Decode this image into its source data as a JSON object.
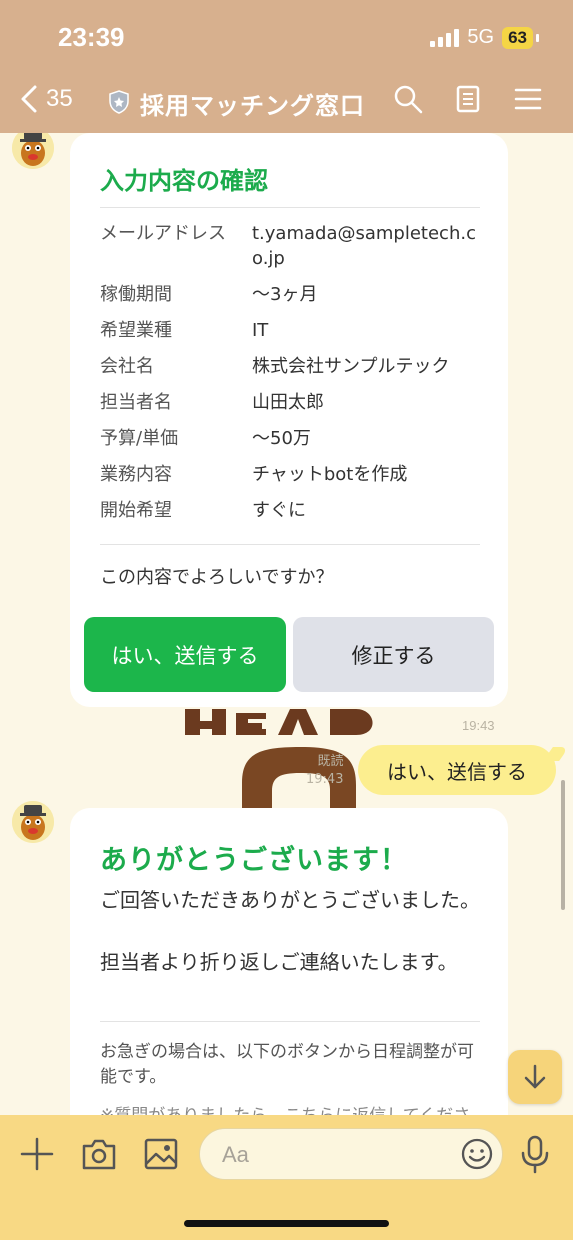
{
  "status": {
    "time": "23:39",
    "network": "5G",
    "battery": "63"
  },
  "header": {
    "back_count": "35",
    "title": "採用マッチング窓口"
  },
  "confirm_card": {
    "title": "入力内容の確認",
    "rows": [
      {
        "label": "メールアドレス",
        "value": "t.yamada@sampletech.co.jp"
      },
      {
        "label": "稼働期間",
        "value": "〜3ヶ月"
      },
      {
        "label": "希望業種",
        "value": "IT"
      },
      {
        "label": "会社名",
        "value": "株式会社サンプルテック"
      },
      {
        "label": "担当者名",
        "value": "山田太郎"
      },
      {
        "label": "予算/単価",
        "value": "〜50万"
      },
      {
        "label": "業務内容",
        "value": "チャットbotを作成"
      },
      {
        "label": "開始希望",
        "value": "すぐに"
      }
    ],
    "question": "この内容でよろしいですか？",
    "yes_label": "はい、送信する",
    "fix_label": "修正する"
  },
  "sticker_time": "19:43",
  "my_message": {
    "text": "はい、送信する",
    "read": "既読",
    "time": "19:43"
  },
  "thanks_card": {
    "title": "ありがとうございます！",
    "line1": "ご回答いただきありがとうございました。",
    "line2": "担当者より折り返しご連絡いたします。",
    "note": "お急ぎの場合は、以下のボタンから日程調整が可能です。",
    "note2": "※質問がありましたら、こちらに返信してください"
  },
  "input": {
    "placeholder": "Aa"
  },
  "colors": {
    "header": "#d7b08e",
    "accent_green": "#1cb64b",
    "bubble_yellow": "#fcee8f",
    "input_bar": "#f8d984"
  },
  "icons": [
    "back-chevron-icon",
    "shield-icon",
    "search-icon",
    "notes-icon",
    "menu-icon",
    "plus-icon",
    "camera-icon",
    "image-icon",
    "emoji-icon",
    "mic-icon",
    "arrow-down-icon"
  ]
}
